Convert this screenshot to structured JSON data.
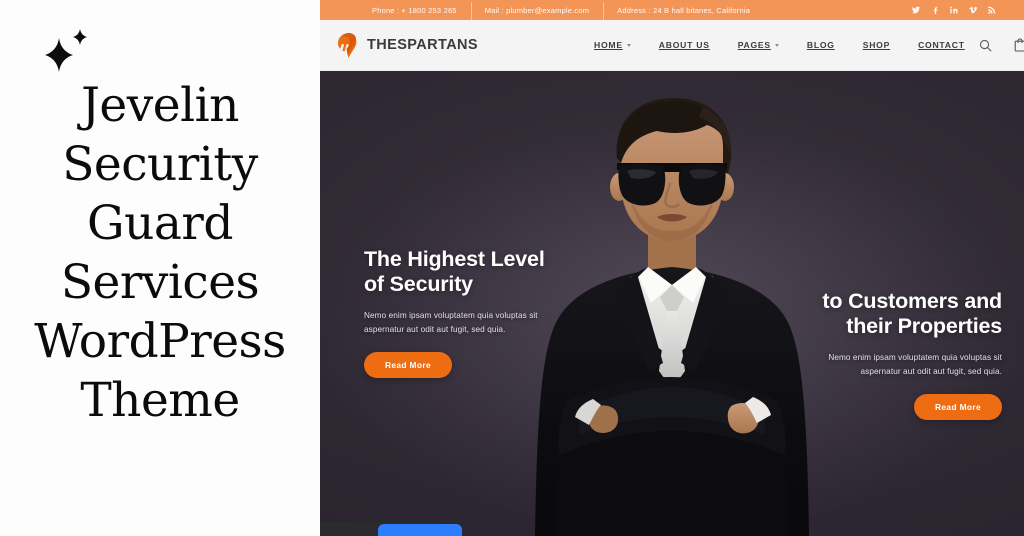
{
  "promo": {
    "sparkle_icon": "sparkle-icon",
    "title_lines": [
      "Jevelin",
      "Security",
      "Guard",
      "Services",
      "WordPress",
      "Theme"
    ],
    "title_full": "Jevelin Security Guard Services WordPress Theme"
  },
  "site": {
    "topbar": {
      "background_color": "#f49558",
      "items": [
        {
          "label": "Phone :  + 1800 253 265"
        },
        {
          "label": "Mail : plumber@example.com"
        },
        {
          "label": "Address : 24 B hall bitanes, California"
        }
      ],
      "social": [
        {
          "name": "twitter-icon",
          "label": "Twitter"
        },
        {
          "name": "facebook-icon",
          "label": "Facebook"
        },
        {
          "name": "linkedin-icon",
          "label": "LinkedIn"
        },
        {
          "name": "vimeo-icon",
          "label": "Vimeo"
        },
        {
          "name": "rss-icon",
          "label": "RSS"
        }
      ]
    },
    "header": {
      "background_color": "#f5f4f4",
      "logo": {
        "icon": "spartan-helmet-icon",
        "text": "THESPARTANS",
        "color": "#ee6c12"
      },
      "nav": [
        {
          "label": "HOME",
          "has_dropdown": true
        },
        {
          "label": "ABOUT US",
          "has_dropdown": false
        },
        {
          "label": "PAGES",
          "has_dropdown": true
        },
        {
          "label": "BLOG",
          "has_dropdown": false
        },
        {
          "label": "SHOP",
          "has_dropdown": false
        },
        {
          "label": "CONTACT",
          "has_dropdown": false
        }
      ],
      "icons": [
        {
          "name": "search-icon",
          "label": "Search"
        },
        {
          "name": "cart-icon",
          "label": "Cart"
        }
      ]
    },
    "hero": {
      "background_color": "#3f3646",
      "accent_color": "#ee6c12",
      "left": {
        "heading": "The Highest Level of Security",
        "heading_line1": "The Highest Level",
        "heading_line2": "of Security",
        "paragraph": "Nemo enim ipsam voluptatem quia voluptas sit aspernatur aut odit aut fugit, sed quia.",
        "button_label": "Read More"
      },
      "right": {
        "heading": "to Customers and their Properties",
        "heading_line1": "to Customers and",
        "heading_line2": "their Properties",
        "paragraph": "Nemo enim ipsam voluptatem quia voluptas sit aspernatur aut odit aut fugit, sed quia.",
        "button_label": "Read More"
      },
      "subject": "security-guard-man-photo"
    }
  }
}
